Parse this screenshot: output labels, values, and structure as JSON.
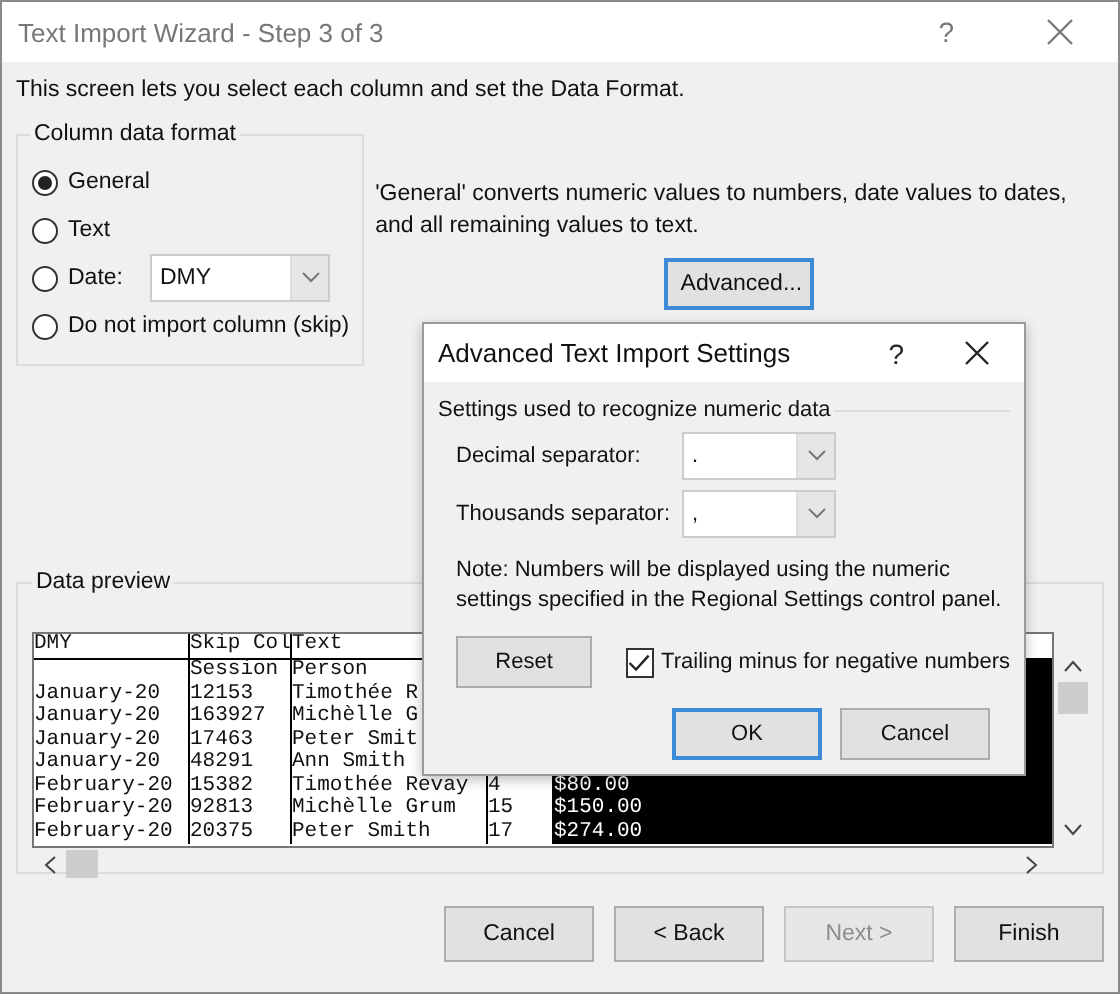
{
  "window": {
    "title": "Text Import Wizard - Step 3 of 3",
    "help_button": "?"
  },
  "intro": "This screen lets you select each column and set the Data Format.",
  "column_format": {
    "legend": "Column data format",
    "options": [
      {
        "label": "General",
        "selected": true,
        "kind": "radio"
      },
      {
        "label": "Text",
        "selected": false,
        "kind": "radio"
      },
      {
        "label": "Date:",
        "selected": false,
        "kind": "radio-dropdown",
        "value": "DMY"
      },
      {
        "label": "Do not import column (skip)",
        "selected": false,
        "kind": "radio"
      }
    ]
  },
  "description": "'General' converts numeric values to numbers, date values to dates, and all remaining values to text.",
  "advanced_button": {
    "label": "Advanced...",
    "focused": true
  },
  "preview": {
    "legend": "Data preview",
    "columns": [
      {
        "header": "DMY",
        "selected": false
      },
      {
        "header": "Skip Col",
        "selected": false
      },
      {
        "header": "Text",
        "selected": false
      },
      {
        "selected": false
      },
      {
        "selected": true
      }
    ],
    "rows": [
      [
        null,
        "Session",
        "Person",
        null,
        null
      ],
      [
        "January-20",
        "12153",
        "Timothée R",
        null,
        null
      ],
      [
        "January-20",
        "163927",
        "Michèlle G",
        null,
        null
      ],
      [
        "January-20",
        "17463",
        "Peter Smit",
        null,
        null
      ],
      [
        "January-20",
        "48291",
        "Ann Smith",
        null,
        null
      ],
      [
        "February-20",
        "15382",
        "Timothée Revay",
        "4",
        "$80.00"
      ],
      [
        "February-20",
        "92813",
        "Michèlle Grum",
        "15",
        "$150.00"
      ],
      [
        "February-20",
        "20375",
        "Peter Smith",
        "17",
        "$274.00"
      ]
    ]
  },
  "buttons": [
    {
      "label": "Cancel",
      "disabled": false
    },
    {
      "label": "< Back",
      "disabled": false
    },
    {
      "label": "Next >",
      "disabled": true
    },
    {
      "label": "Finish",
      "disabled": false
    }
  ],
  "dialog": {
    "title": "Advanced Text Import Settings",
    "help_button": "?",
    "section": "Settings used to recognize numeric data",
    "fields": [
      {
        "label": "Decimal separator:",
        "value": "."
      },
      {
        "label": "Thousands separator:",
        "value": ","
      }
    ],
    "note": "Note: Numbers will be displayed using the numeric settings specified in the Regional Settings control panel.",
    "reset_button": "Reset",
    "trailing_minus": {
      "label": "Trailing minus for negative numbers",
      "checked": true
    },
    "ok_button": {
      "label": "OK",
      "focused": true
    },
    "cancel_button": "Cancel"
  }
}
